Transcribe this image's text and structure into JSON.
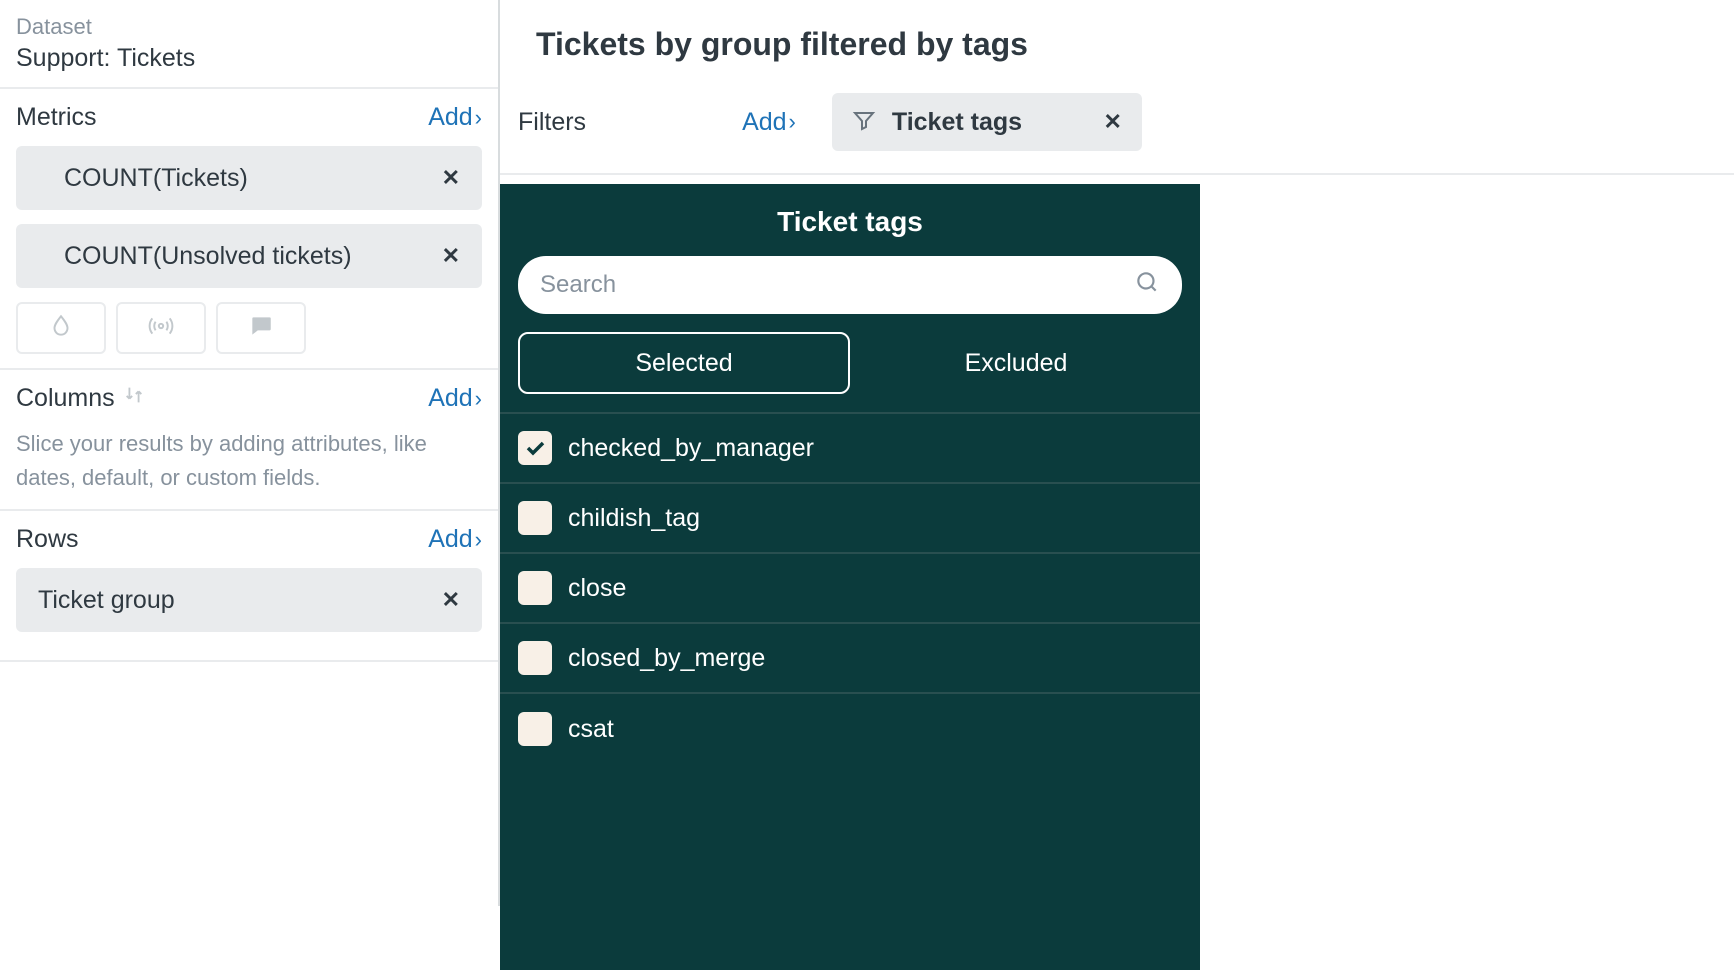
{
  "sidebar": {
    "dataset_label": "Dataset",
    "dataset_value": "Support: Tickets",
    "metrics": {
      "title": "Metrics",
      "add": "Add",
      "items": [
        {
          "label": "COUNT(Tickets)"
        },
        {
          "label": "COUNT(Unsolved tickets)"
        }
      ]
    },
    "columns": {
      "title": "Columns",
      "add": "Add",
      "hint": "Slice your results by adding attributes, like dates, default, or custom fields."
    },
    "rows": {
      "title": "Rows",
      "add": "Add",
      "items": [
        {
          "label": "Ticket group"
        }
      ]
    }
  },
  "main": {
    "title": "Tickets by group filtered by tags",
    "filters_label": "Filters",
    "filters_add": "Add",
    "filter_chip": {
      "label": "Ticket tags"
    }
  },
  "panel": {
    "title": "Ticket tags",
    "search_placeholder": "Search",
    "tab_selected": "Selected",
    "tab_excluded": "Excluded",
    "options": [
      {
        "label": "checked_by_manager",
        "checked": true
      },
      {
        "label": "childish_tag",
        "checked": false
      },
      {
        "label": "close",
        "checked": false
      },
      {
        "label": "closed_by_merge",
        "checked": false
      },
      {
        "label": "csat",
        "checked": false
      }
    ]
  }
}
